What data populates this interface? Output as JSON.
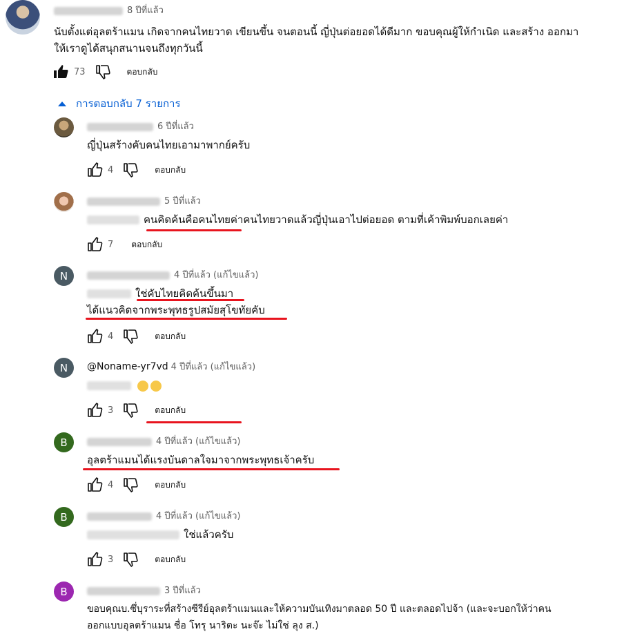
{
  "thread": {
    "author_time": "8 ปีที่แล้ว",
    "text_line1": "นับตั้งแต่อุลตร้าแมน เกิดจากคนไทยวาด เขียนขึ้น  จนตอนนี้ ญี่ปุ่นต่อยอดได้ดีมาก ขอบคุณผู้ให้กำเนิด และสร้าง ออกมา",
    "text_line2": "ให้เราดูได้สนุกสนานจนถึงทุกวันนี้",
    "likes": "73",
    "reply_label": "ตอบกลับ"
  },
  "replies_toggle": "การตอบกลับ 7 รายการ",
  "replies": [
    {
      "time": "6 ปีที่แล้ว",
      "text": "ญี่ปุ่นสร้างคับคนไทยเอามาพากย์ครับ",
      "likes": "4",
      "reply_label": "ตอบกลับ"
    },
    {
      "time": "5 ปีที่แล้ว",
      "text": "คนคิดค้นคือคนไทยค่าคนไทยวาดแล้วญี่ปุ่นเอาไปต่อยอด ตามที่เค้าพิมพ์บอกเลยค่า",
      "likes": "7",
      "reply_label": "ตอบกลับ"
    },
    {
      "avatar_letter": "N",
      "time": "4 ปีที่แล้ว (แก้ไขแล้ว)",
      "text_line1": "ใช่คับไทยคิดค้นขึ้นมา",
      "text_line2": "ได้แนวคิดจากพระพุทธรูปสมัยสุโขทัยคับ",
      "likes": "4",
      "reply_label": "ตอบกลับ"
    },
    {
      "avatar_letter": "N",
      "author": "@Noname-yr7vd",
      "time": "4 ปีที่แล้ว (แก้ไขแล้ว)",
      "likes": "3",
      "reply_label": "ตอบกลับ"
    },
    {
      "avatar_letter": "B",
      "time": "4 ปีที่แล้ว (แก้ไขแล้ว)",
      "text": "อุลตร้าแมนได้แรงบันดาลใจมาจากพระพุทธเจ้าครับ",
      "likes": "4",
      "reply_label": "ตอบกลับ"
    },
    {
      "avatar_letter": "B",
      "time": "4 ปีที่แล้ว (แก้ไขแล้ว)",
      "text": "ใช่แล้วครับ",
      "likes": "3",
      "reply_label": "ตอบกลับ"
    },
    {
      "avatar_letter": "B",
      "time": "3 ปีที่แล้ว",
      "text_line1": "ขอบคุณบ.ซึ่บุราระที่สร้างซีรีย์อุลตร้าแมนและให้ความบันเทิงมาตลอด 50 ปี และตลอดไปจ้า (และจะบอกให้ว่าคน",
      "text_line2": "ออกแบบอุลตร้าแมน ชื่อ โทรุ นาริตะ นะจ๊ะ ไม่ใช่ ลุง ส.)"
    }
  ],
  "colors": {
    "link_blue": "#065fd4",
    "avatar_n": "#4a5a63",
    "avatar_b_green": "#33691e",
    "avatar_b_purple": "#9c27b0",
    "highlight_red": "#e8141e"
  }
}
